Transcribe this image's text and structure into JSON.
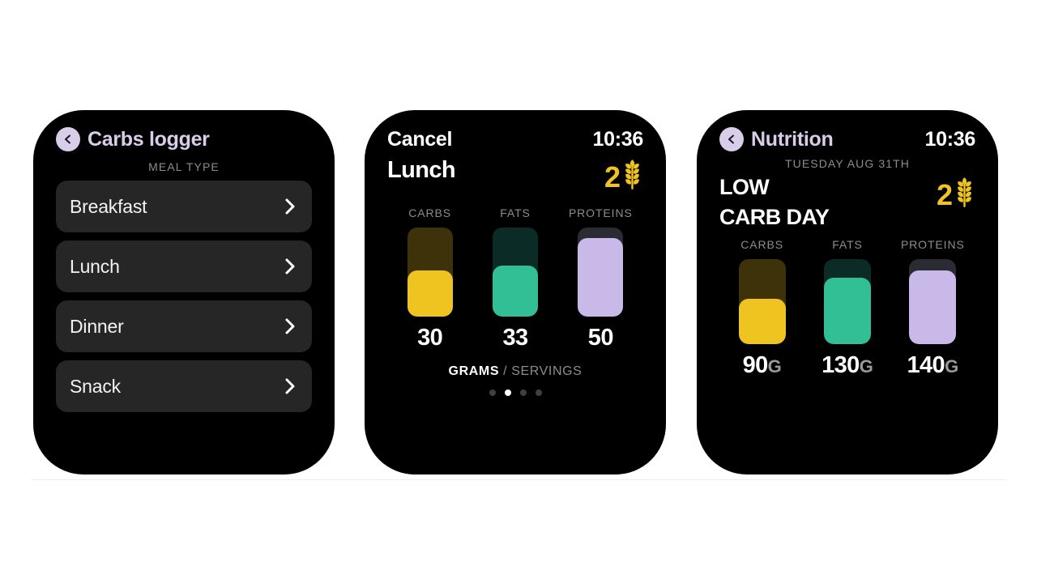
{
  "palette": {
    "page_background": "#ffffff",
    "watch_body": "#000000",
    "accent_purple": "#d9cdea",
    "carbs_fill": "#efc420",
    "carbs_track": "#3d3209",
    "fats_fill": "#33bf95",
    "fats_track": "#0b2b26",
    "proteins_fill": "#c9b9e8",
    "proteins_track": "#2b2b33",
    "card_background": "#262626",
    "muted_text": "#8c8c8c"
  },
  "screen1": {
    "back_icon": "chevron-left-icon",
    "title": "Carbs logger",
    "section_label": "MEAL TYPE",
    "meals": [
      {
        "label": "Breakfast",
        "chevron": "chevron-right-icon"
      },
      {
        "label": "Lunch",
        "chevron": "chevron-right-icon"
      },
      {
        "label": "Dinner",
        "chevron": "chevron-right-icon"
      },
      {
        "label": "Snack",
        "chevron": "chevron-right-icon"
      }
    ]
  },
  "screen2": {
    "cancel_label": "Cancel",
    "time": "10:36",
    "meal_title": "Lunch",
    "grain_count": "2",
    "grain_icon": "wheat-icon",
    "macros": [
      {
        "label": "CARBS",
        "value": "30",
        "fill_percent": 52
      },
      {
        "label": "FATS",
        "value": "33",
        "fill_percent": 57
      },
      {
        "label": "PROTEINS",
        "value": "50",
        "fill_percent": 88
      }
    ],
    "units": {
      "selected": "GRAMS",
      "separator": "/",
      "other": "SERVINGS"
    },
    "pagination": {
      "total": 4,
      "active_index": 1
    }
  },
  "screen3": {
    "back_icon": "chevron-left-icon",
    "title": "Nutrition",
    "time": "10:36",
    "date": "TUESDAY AUG 31TH",
    "headline_line1": "LOW",
    "headline_line2": "CARB DAY",
    "grain_count": "2",
    "grain_icon": "wheat-icon",
    "macros": [
      {
        "label": "CARBS",
        "value": "90",
        "unit": "G",
        "fill_percent": 53
      },
      {
        "label": "FATS",
        "value": "130",
        "unit": "G",
        "fill_percent": 78
      },
      {
        "label": "PROTEINS",
        "value": "140",
        "unit": "G",
        "fill_percent": 87
      }
    ]
  },
  "chart_data": [
    {
      "type": "bar",
      "title": "Lunch",
      "categories": [
        "CARBS",
        "FATS",
        "PROTEINS"
      ],
      "values": [
        30,
        33,
        50
      ],
      "unit": "grams",
      "fill_percent": [
        52,
        57,
        88
      ],
      "colors": [
        "#efc420",
        "#33bf95",
        "#c9b9e8"
      ],
      "xlabel": "",
      "ylabel": "",
      "grid": false,
      "legend": "none"
    },
    {
      "type": "bar",
      "title": "LOW CARB DAY",
      "subtitle": "TUESDAY AUG 31TH",
      "categories": [
        "CARBS",
        "FATS",
        "PROTEINS"
      ],
      "values": [
        90,
        130,
        140
      ],
      "unit": "G",
      "fill_percent": [
        53,
        78,
        87
      ],
      "colors": [
        "#efc420",
        "#33bf95",
        "#c9b9e8"
      ],
      "xlabel": "",
      "ylabel": "",
      "grid": false,
      "legend": "none"
    }
  ]
}
